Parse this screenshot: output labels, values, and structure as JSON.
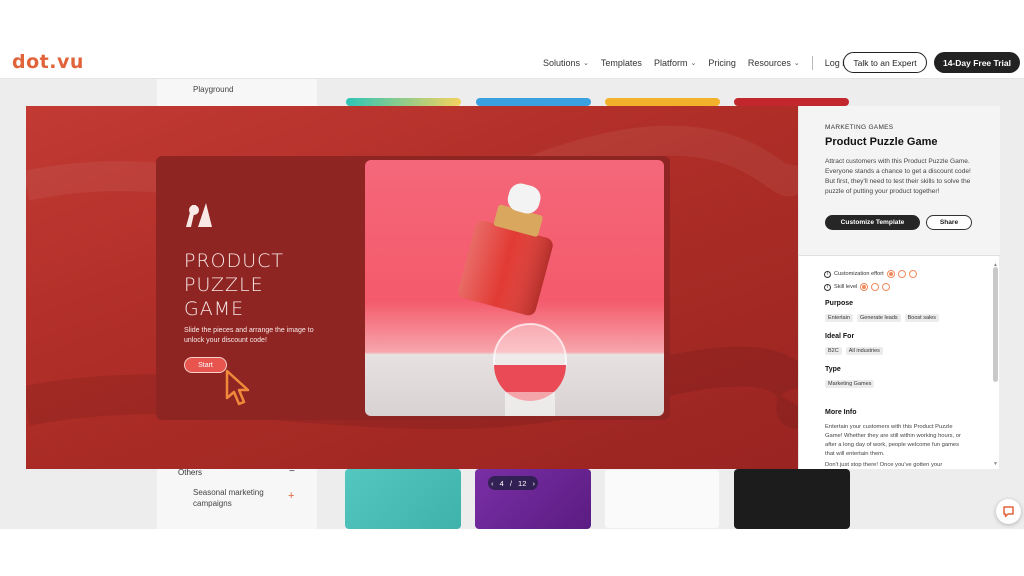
{
  "brand": {
    "logo_text": "dot.vu",
    "accent": "#e0633a"
  },
  "nav": {
    "items": [
      {
        "label": "Solutions",
        "has_dropdown": true
      },
      {
        "label": "Templates",
        "has_dropdown": false
      },
      {
        "label": "Platform",
        "has_dropdown": true
      },
      {
        "label": "Pricing",
        "has_dropdown": false
      },
      {
        "label": "Resources",
        "has_dropdown": true
      }
    ],
    "login": "Log in",
    "talk_expert": "Talk to an Expert",
    "free_trial": "14-Day Free Trial"
  },
  "background": {
    "sidebar_playground": "Playground",
    "sidebar_others": "Others",
    "sidebar_seasonal": "Seasonal marketing campaigns"
  },
  "pager": {
    "current": "4",
    "separator": "/",
    "total": "12",
    "prev": "‹",
    "next": "›"
  },
  "preview": {
    "game_title": "PRODUCT PUZZLE GAME",
    "game_desc": "Slide the pieces and arrange the image to unlock your discount code!",
    "start_label": "Start"
  },
  "panel": {
    "eyebrow": "MARKETING GAMES",
    "title": "Product Puzzle Game",
    "description": "Attract customers with this Product Puzzle Game. Everyone stands a chance to get a discount code! But first, they'll need to test their skills to solve the puzzle of putting your product together!",
    "customize_label": "Customize Template",
    "share_label": "Share",
    "customization_effort_label": "Customization effort",
    "customization_effort_level": 1,
    "skill_level_label": "Skill level",
    "skill_level": 1,
    "max_level": 3,
    "purpose_heading": "Purpose",
    "purpose_tags": [
      "Entertain",
      "Generate leads",
      "Boost sales"
    ],
    "ideal_for_heading": "Ideal For",
    "ideal_for_tags": [
      "B2C",
      "All industries"
    ],
    "type_heading": "Type",
    "type_tags": [
      "Marketing Games"
    ],
    "more_info_heading": "More Info",
    "more_info_p1": "Entertain your customers with this Product Puzzle Game! Whether they are still within working hours, or after a long day of work, people welcome fun games that will entertain them.",
    "more_info_p2": "Don't just stop there! Once you've gotten your"
  }
}
